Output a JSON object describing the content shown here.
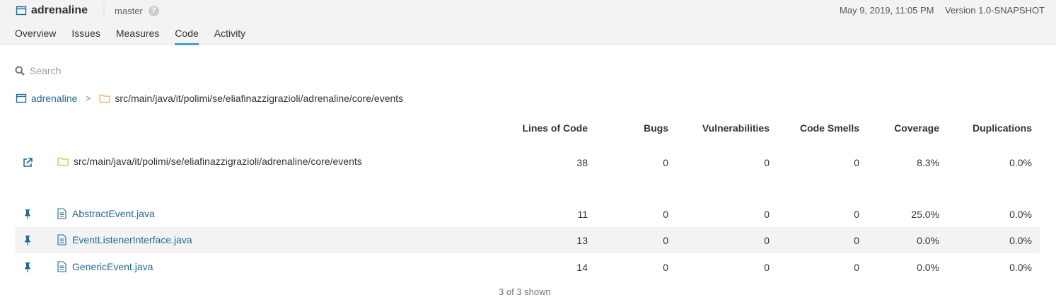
{
  "header": {
    "project_name": "adrenaline",
    "branch": "master",
    "help": "?",
    "date": "May 9, 2019, 11:05 PM",
    "version": "Version 1.0-SNAPSHOT"
  },
  "tabs": [
    {
      "label": "Overview"
    },
    {
      "label": "Issues"
    },
    {
      "label": "Measures"
    },
    {
      "label": "Code",
      "active": true
    },
    {
      "label": "Activity"
    }
  ],
  "search": {
    "placeholder": "Search"
  },
  "breadcrumb": {
    "root": "adrenaline",
    "separator": ">",
    "path": "src/main/java/it/polimi/se/eliafinazzigrazioli/adrenaline/core/events"
  },
  "columns": [
    "Lines of Code",
    "Bugs",
    "Vulnerabilities",
    "Code Smells",
    "Coverage",
    "Duplications"
  ],
  "directory_row": {
    "name": "src/main/java/it/polimi/se/eliafinazzigrazioli/adrenaline/core/events",
    "values": [
      "38",
      "0",
      "0",
      "0",
      "8.3%",
      "0.0%"
    ],
    "icon": "external-link-icon"
  },
  "files": [
    {
      "name": "AbstractEvent.java",
      "values": [
        "11",
        "0",
        "0",
        "0",
        "25.0%",
        "0.0%"
      ],
      "icon": "pin-icon"
    },
    {
      "name": "EventListenerInterface.java",
      "values": [
        "13",
        "0",
        "0",
        "0",
        "0.0%",
        "0.0%"
      ],
      "icon": "pin-icon"
    },
    {
      "name": "GenericEvent.java",
      "values": [
        "14",
        "0",
        "0",
        "0",
        "0.0%",
        "0.0%"
      ],
      "icon": "pin-icon"
    }
  ],
  "footer": {
    "shown": "3 of 3 shown"
  },
  "colors": {
    "link": "#236a97",
    "active_tab": "#4b9fd5",
    "folder": "#f0ad4e",
    "background_bar": "#f3f3f3"
  }
}
